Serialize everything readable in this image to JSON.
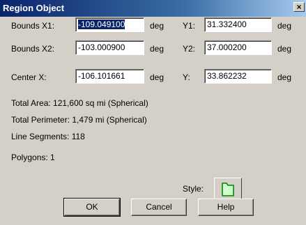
{
  "window": {
    "title": "Region Object",
    "close_glyph": "×"
  },
  "bounds_x1": {
    "label": "Bounds X1:",
    "value": "-109.049100",
    "unit": "deg"
  },
  "bounds_y1": {
    "label": "Y1:",
    "value": "31.332400",
    "unit": "deg"
  },
  "bounds_x2": {
    "label": "Bounds X2:",
    "value": "-103.000900",
    "unit": "deg"
  },
  "bounds_y2": {
    "label": "Y2:",
    "value": "37.000200",
    "unit": "deg"
  },
  "center_x": {
    "label": "Center X:",
    "value": "-106.101661",
    "unit": "deg"
  },
  "center_y": {
    "label": "Y:",
    "value": "33.862232",
    "unit": "deg"
  },
  "info": {
    "total_area": "Total Area:  121,600 sq mi (Spherical)",
    "total_perimeter": "Total Perimeter:  1,479 mi (Spherical)",
    "line_segments": "Line Segments:  118",
    "polygons": "Polygons:  1"
  },
  "style": {
    "label": "Style:",
    "fill_color": "#ccffcc",
    "border_color": "#008000",
    "icon": "region-style-swatch-icon"
  },
  "buttons": {
    "ok": "OK",
    "cancel": "Cancel",
    "help": "Help"
  },
  "colors": {
    "title_bar": "#0a246a",
    "selection": "#0a246a",
    "dialog_bg": "#d4d0c8"
  }
}
